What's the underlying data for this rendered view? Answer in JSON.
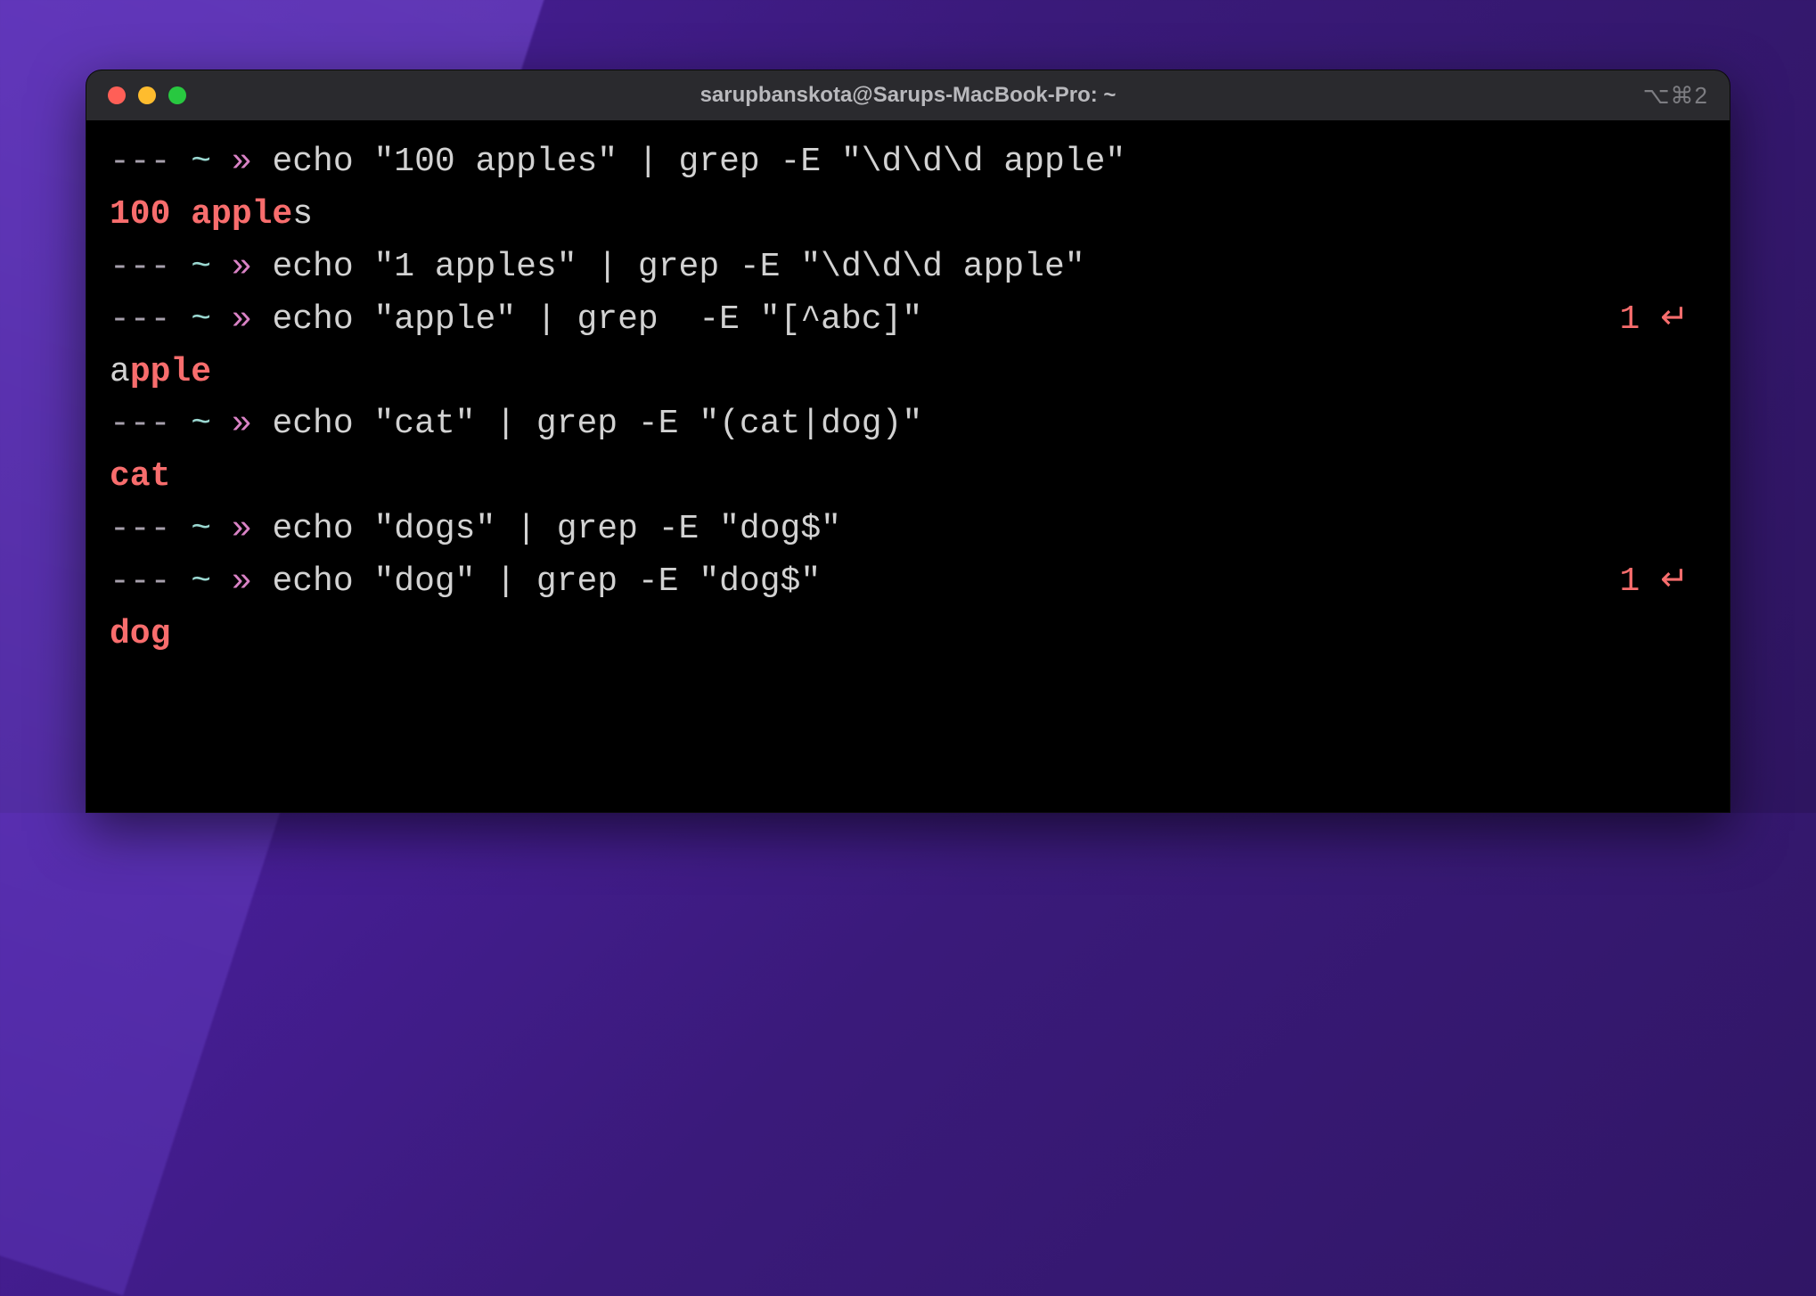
{
  "window": {
    "title": "sarupbanskota@Sarups-MacBook-Pro: ~",
    "right_indicator": "⌥⌘2"
  },
  "prompt": {
    "dashes": "--- ",
    "tilde": "~ ",
    "arrow": "» "
  },
  "status": {
    "code": "1",
    "return_glyph": "↵"
  },
  "lines": [
    {
      "type": "cmd",
      "command": "echo \"100 apples\" | grep -E \"\\d\\d\\d apple\""
    },
    {
      "type": "out",
      "segments": [
        {
          "t": "100 apple",
          "m": true
        },
        {
          "t": "s",
          "m": false
        }
      ]
    },
    {
      "type": "cmd",
      "command": "echo \"1 apples\" | grep -E \"\\d\\d\\d apple\""
    },
    {
      "type": "cmd",
      "command": "echo \"apple\" | grep  -E \"[^abc]\"",
      "status": true
    },
    {
      "type": "out",
      "segments": [
        {
          "t": "a",
          "m": false
        },
        {
          "t": "pple",
          "m": true
        }
      ]
    },
    {
      "type": "cmd",
      "command": "echo \"cat\" | grep -E \"(cat|dog)\""
    },
    {
      "type": "out",
      "segments": [
        {
          "t": "cat",
          "m": true
        }
      ]
    },
    {
      "type": "cmd",
      "command": "echo \"dogs\" | grep -E \"dog$\""
    },
    {
      "type": "cmd",
      "command": "echo \"dog\" | grep -E \"dog$\"",
      "status": true
    },
    {
      "type": "out",
      "segments": [
        {
          "t": "dog",
          "m": true
        }
      ]
    }
  ]
}
